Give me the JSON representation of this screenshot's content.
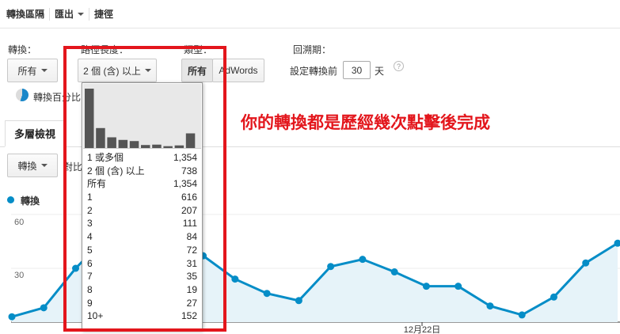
{
  "toolbar": {
    "conversion_segment": "轉換區隔",
    "export": "匯出",
    "shortcut": "捷徑"
  },
  "filters": {
    "conversion_label": "轉換：",
    "conversion_value": "所有",
    "path_length_label": "路徑長度：",
    "path_length_value": "2 個 (含) 以上",
    "type_label": "類型：",
    "type_all": "所有",
    "type_adwords": "AdWords",
    "lookback_label": "回溯期：",
    "lookback_prefix": "設定轉換前",
    "lookback_days": "30",
    "lookback_unit": "天",
    "help_icon": "?"
  },
  "percent_label": "轉換百分比",
  "tab": {
    "label": "多層檢視"
  },
  "metric": {
    "value": "轉換",
    "compare": "對比"
  },
  "legend": {
    "label": "轉換"
  },
  "histogram": [
    616,
    207,
    111,
    84,
    72,
    31,
    35,
    19,
    27,
    152
  ],
  "dropdown_items": [
    {
      "label": "1 或多個",
      "count": "1,354"
    },
    {
      "label": "2 個 (含) 以上",
      "count": "738"
    },
    {
      "label": "所有",
      "count": "1,354"
    },
    {
      "label": "1",
      "count": "616"
    },
    {
      "label": "2",
      "count": "207"
    },
    {
      "label": "3",
      "count": "111"
    },
    {
      "label": "4",
      "count": "84"
    },
    {
      "label": "5",
      "count": "72"
    },
    {
      "label": "6",
      "count": "31"
    },
    {
      "label": "7",
      "count": "35"
    },
    {
      "label": "8",
      "count": "19"
    },
    {
      "label": "9",
      "count": "27"
    },
    {
      "label": "10+",
      "count": "152"
    }
  ],
  "chart_data": {
    "type": "line",
    "series": [
      {
        "name": "轉換",
        "values": [
          3,
          8,
          30,
          48,
          42,
          38,
          37,
          24,
          16,
          12,
          31,
          35,
          28,
          20,
          20,
          9,
          4,
          14,
          33,
          44
        ]
      }
    ],
    "x_tick_labels": [
      "12月22日"
    ],
    "y_tick_labels": [
      "60",
      "30"
    ],
    "ylim": [
      0,
      60
    ],
    "color": "#058dc7",
    "fill": "#e6f3f9"
  },
  "annotation": "你的轉換都是歷經幾次點擊後完成",
  "colors": {
    "accent": "#058dc7",
    "annotation": "#e3161c"
  }
}
